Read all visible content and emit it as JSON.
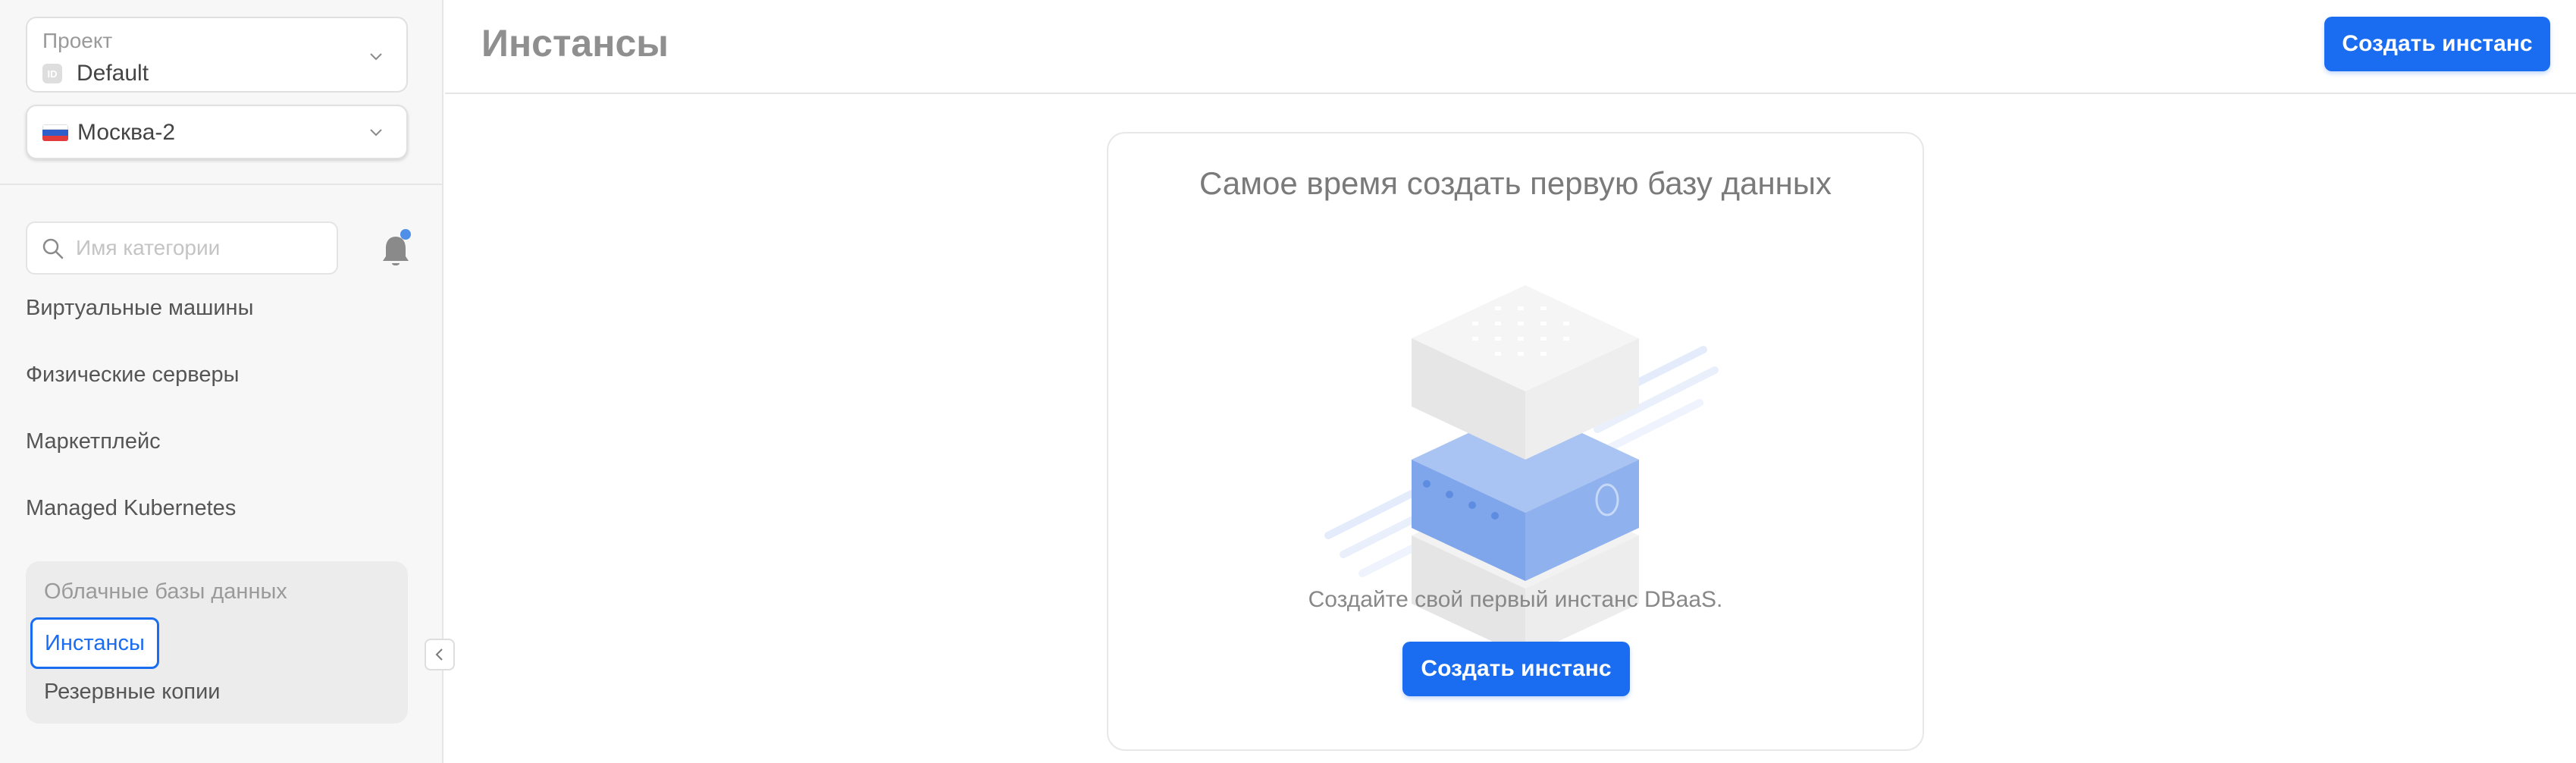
{
  "sidebar": {
    "project": {
      "label": "Проект",
      "id_badge": "ID",
      "value": "Default"
    },
    "region": {
      "value": "Москва-2",
      "flag_colors": [
        "#ffffff",
        "#2d5ec9",
        "#e23b3b"
      ]
    },
    "search": {
      "placeholder": "Имя категории"
    },
    "nav": [
      {
        "label": "Виртуальные машины"
      },
      {
        "label": "Физические серверы"
      },
      {
        "label": "Маркетплейс"
      },
      {
        "label": "Managed Kubernetes"
      }
    ],
    "group": {
      "title": "Облачные базы данных",
      "items": [
        {
          "label": "Инстансы",
          "active": true
        },
        {
          "label": "Резервные копии",
          "active": false
        }
      ]
    }
  },
  "header": {
    "title": "Инстансы",
    "create_button": "Создать инстанс"
  },
  "empty_state": {
    "title": "Самое время создать первую базу данных",
    "description": "Создайте свой первый инстанс DBaaS.",
    "button": "Создать инстанс"
  },
  "colors": {
    "accent": "#1a6cf0",
    "notification_dot": "#4f8fe8",
    "illustration_blue": "#7fa6ea"
  },
  "icons": [
    "chevron-down-icon",
    "flag-ru-icon",
    "search-icon",
    "bell-icon",
    "chevron-left-icon",
    "database-illustration"
  ]
}
